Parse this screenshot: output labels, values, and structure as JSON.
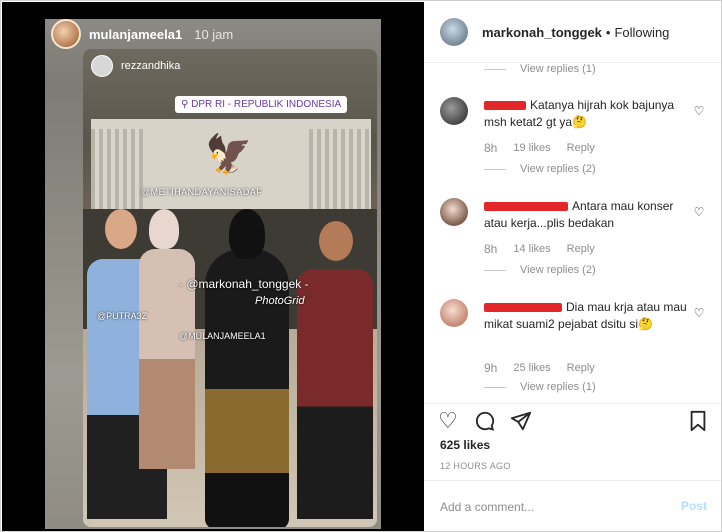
{
  "colors": {
    "accent": "#3897f0",
    "muted": "#8e8e8e",
    "text": "#262626",
    "post_disabled": "#b2dffc",
    "redaction": "#e3262a",
    "location_text": "#6a3aa0"
  },
  "story": {
    "username": "mulanjameela1",
    "time": "10 jam",
    "inner_username": "rezzandhika",
    "location": "DPR RI - REPUBLIK INDONESIA",
    "overlay_tags": {
      "meti": "@METIHANDAYANISADAF",
      "markonah": "- @markonah_tonggek -",
      "photogrid": "PhotoGrid",
      "putra": "@PUTRA3Z",
      "mulan": "@MULANJAMEELA1"
    }
  },
  "post_header": {
    "username": "markonah_tonggek",
    "separator": "•",
    "follow_status": "Following"
  },
  "comments": [
    {
      "username_redacted": true,
      "text": "Katanya hijrah kok bajunya msh ketat2 gt ya🤔",
      "time": "8h",
      "likes": "19 likes",
      "reply": "Reply",
      "view_replies": "View replies (2)"
    },
    {
      "username_redacted": true,
      "text": "Antara mau konser atau kerja...plis bedakan",
      "time": "8h",
      "likes": "14 likes",
      "reply": "Reply",
      "view_replies": "View replies (2)"
    },
    {
      "username_redacted": true,
      "text": "Dia mau krja atau mau mikat suami2 pejabat dsitu si🤔",
      "time": "9h",
      "likes": "25 likes",
      "reply": "Reply",
      "view_replies": "View replies (1)"
    }
  ],
  "top_view_replies": "View replies (1)",
  "actions": {
    "like_icon": "heart-outline-icon",
    "comment_icon": "comment-bubble-icon",
    "share_icon": "paper-plane-icon",
    "save_icon": "bookmark-icon"
  },
  "likes": "625 likes",
  "timestamp": "12 HOURS AGO",
  "add_comment": {
    "placeholder": "Add a comment...",
    "post_label": "Post"
  }
}
